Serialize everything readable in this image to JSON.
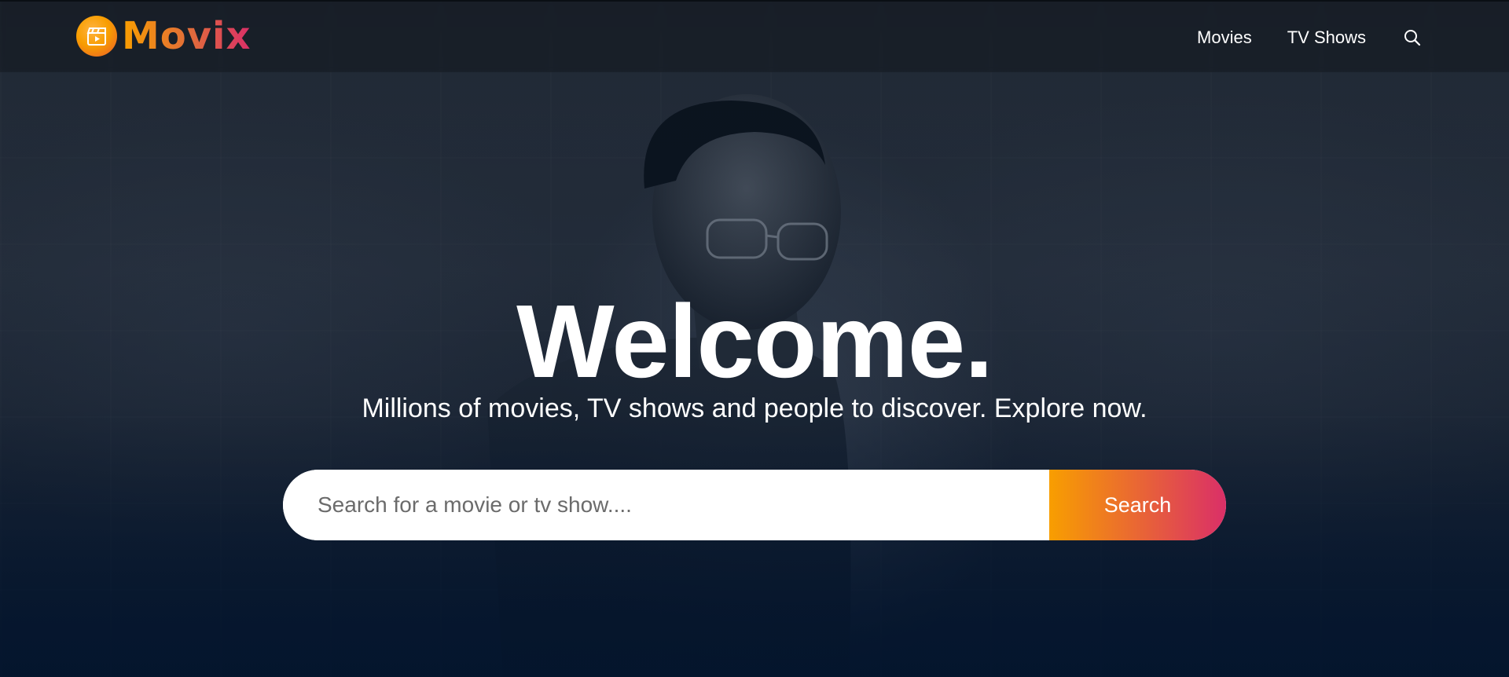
{
  "header": {
    "logo_text": "Movix",
    "nav": [
      {
        "label": "Movies"
      },
      {
        "label": "TV Shows"
      }
    ],
    "search_icon": "search-icon"
  },
  "hero": {
    "title": "Welcome.",
    "subtitle": "Millions of movies, TV shows and people to discover. Explore now.",
    "search": {
      "placeholder": "Search for a movie or tv show....",
      "button_label": "Search"
    }
  },
  "colors": {
    "background": "#04152d",
    "gradient_start": "#f89e00",
    "gradient_end": "#da2f68",
    "text": "#ffffff"
  }
}
